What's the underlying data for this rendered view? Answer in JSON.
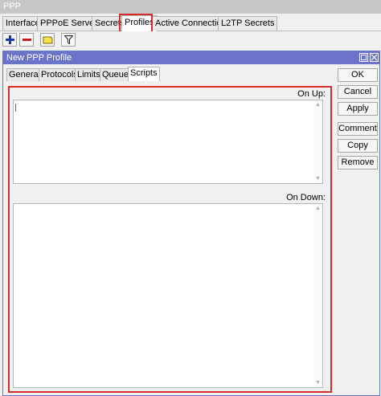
{
  "window": {
    "title": "PPP"
  },
  "tabs": [
    {
      "label": "Interface"
    },
    {
      "label": "PPPoE Servers"
    },
    {
      "label": "Secrets"
    },
    {
      "label": "Profiles"
    },
    {
      "label": "Active Connections"
    },
    {
      "label": "L2TP Secrets"
    }
  ],
  "toolbar": {
    "add_icon": "plus-icon",
    "remove_icon": "minus-icon",
    "comment_icon": "note-icon",
    "filter_icon": "filter-icon"
  },
  "dialog": {
    "title": "New PPP Profile",
    "subtabs": [
      {
        "label": "General"
      },
      {
        "label": "Protocols"
      },
      {
        "label": "Limits"
      },
      {
        "label": "Queue"
      },
      {
        "label": "Scripts"
      }
    ],
    "on_up_label": "On Up:",
    "on_up_value": "",
    "on_down_label": "On Down:",
    "on_down_value": "",
    "buttons": {
      "ok": "OK",
      "cancel": "Cancel",
      "apply": "Apply",
      "comment": "Comment",
      "copy": "Copy",
      "remove": "Remove"
    }
  },
  "colors": {
    "dialog_title_bg": "#6b74c8",
    "highlight": "#d62b2b",
    "add_icon": "#1a3bb3",
    "remove_icon": "#c0212a"
  }
}
